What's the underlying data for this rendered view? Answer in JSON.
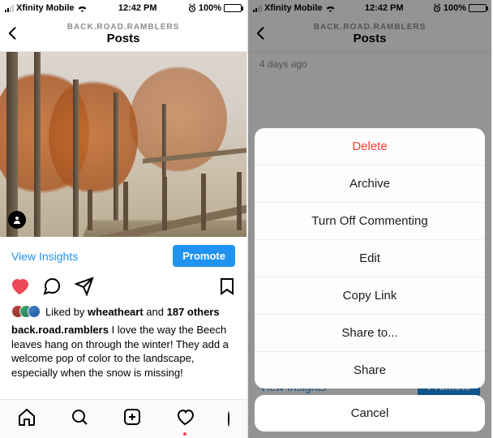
{
  "status": {
    "carrier": "Xfinity Mobile",
    "time": "12:42 PM",
    "battery_pct": "100%"
  },
  "header": {
    "username": "BACK.ROAD.RAMBLERS",
    "title": "Posts"
  },
  "post": {
    "insights_label": "View Insights",
    "promote_label": "Promote",
    "liked_prefix": "Liked by ",
    "liked_by_user": "wheatheart",
    "liked_middle": " and ",
    "liked_others": "187 others",
    "caption_user": "back.road.ramblers",
    "caption_text": " I love the way the Beech leaves hang on through the winter! They add a welcome pop of color to the landscape, especially when the snow is missing!",
    "timestamp": "4 days ago"
  },
  "action_sheet": {
    "items": [
      "Delete",
      "Archive",
      "Turn Off Commenting",
      "Edit",
      "Copy Link",
      "Share to...",
      "Share"
    ],
    "cancel": "Cancel"
  }
}
